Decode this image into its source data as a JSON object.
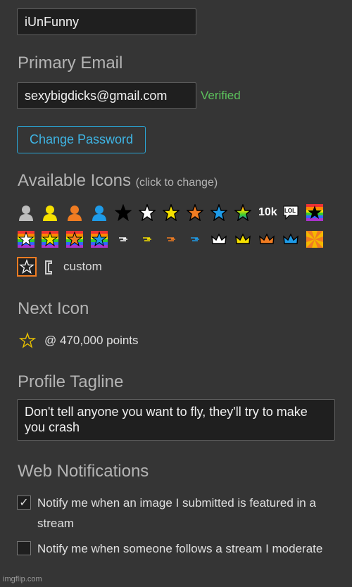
{
  "username": {
    "value": "iUnFunny"
  },
  "email": {
    "heading": "Primary Email",
    "value": "sexybigdicks@gmail.com",
    "status": "Verified",
    "status_color": "#5cc25c"
  },
  "change_password": {
    "label": "Change Password"
  },
  "icons": {
    "heading": "Available Icons",
    "hint": "(click to change)",
    "text_icons": [
      "10k",
      "LOL"
    ],
    "custom_label": "custom",
    "selected": "outlined-star-icon"
  },
  "next_icon": {
    "heading": "Next Icon",
    "points": "@ 470,000 points"
  },
  "tagline": {
    "heading": "Profile Tagline",
    "value": "Don't tell anyone you want to fly, they'll try to make you crash"
  },
  "notifications": {
    "heading": "Web Notifications",
    "items": [
      {
        "label": "Notify me when an image I submitted is featured in a stream",
        "checked": true
      },
      {
        "label": "Notify me when someone follows a stream I moderate",
        "checked": false
      }
    ]
  },
  "watermark": "imgflip.com",
  "colors": {
    "accent": "#2aa6d6",
    "orange": "#f07c22",
    "yellow": "#f5e000",
    "blue": "#1e9be8"
  }
}
